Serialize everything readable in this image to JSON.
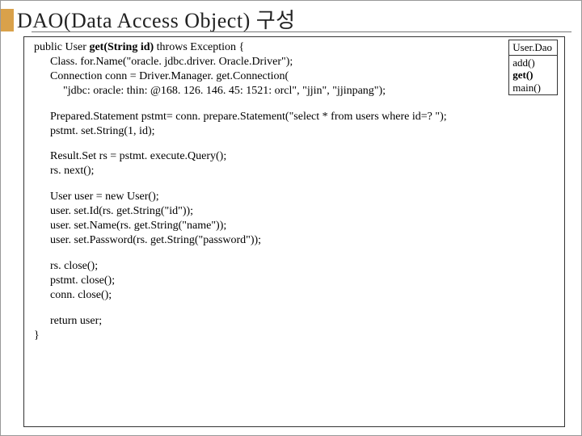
{
  "title": "DAO(Data Access Object)  구성",
  "uml": {
    "name": "User.Dao",
    "m1": "add()",
    "m2": "get()",
    "m3": "main()"
  },
  "code": {
    "sig_pre": "public User ",
    "sig_bold": "get(String id)",
    "sig_post": "  throws  Exception {",
    "l2": "Class. for.Name(\"oracle. jdbc.driver. Oracle.Driver\");",
    "l3": "Connection conn = Driver.Manager. get.Connection(",
    "l4": "\"jdbc: oracle: thin: @168. 126. 146. 45: 1521: orcl\", \"jjin\", \"jjinpang\");",
    "l5": "Prepared.Statement pstmt= conn. prepare.Statement(\"select * from users where id=? \");",
    "l6": "pstmt. set.String(1, id);",
    "l7": "Result.Set rs = pstmt. execute.Query();",
    "l8": "rs. next();",
    "l9": "User user = new User();",
    "l10": "user. set.Id(rs. get.String(\"id\"));",
    "l11": "user. set.Name(rs. get.String(\"name\"));",
    "l12": "user. set.Password(rs. get.String(\"password\"));",
    "l13": "rs. close();",
    "l14": "pstmt. close();",
    "l15": "conn. close();",
    "l16": "return user;",
    "l17": "}"
  }
}
